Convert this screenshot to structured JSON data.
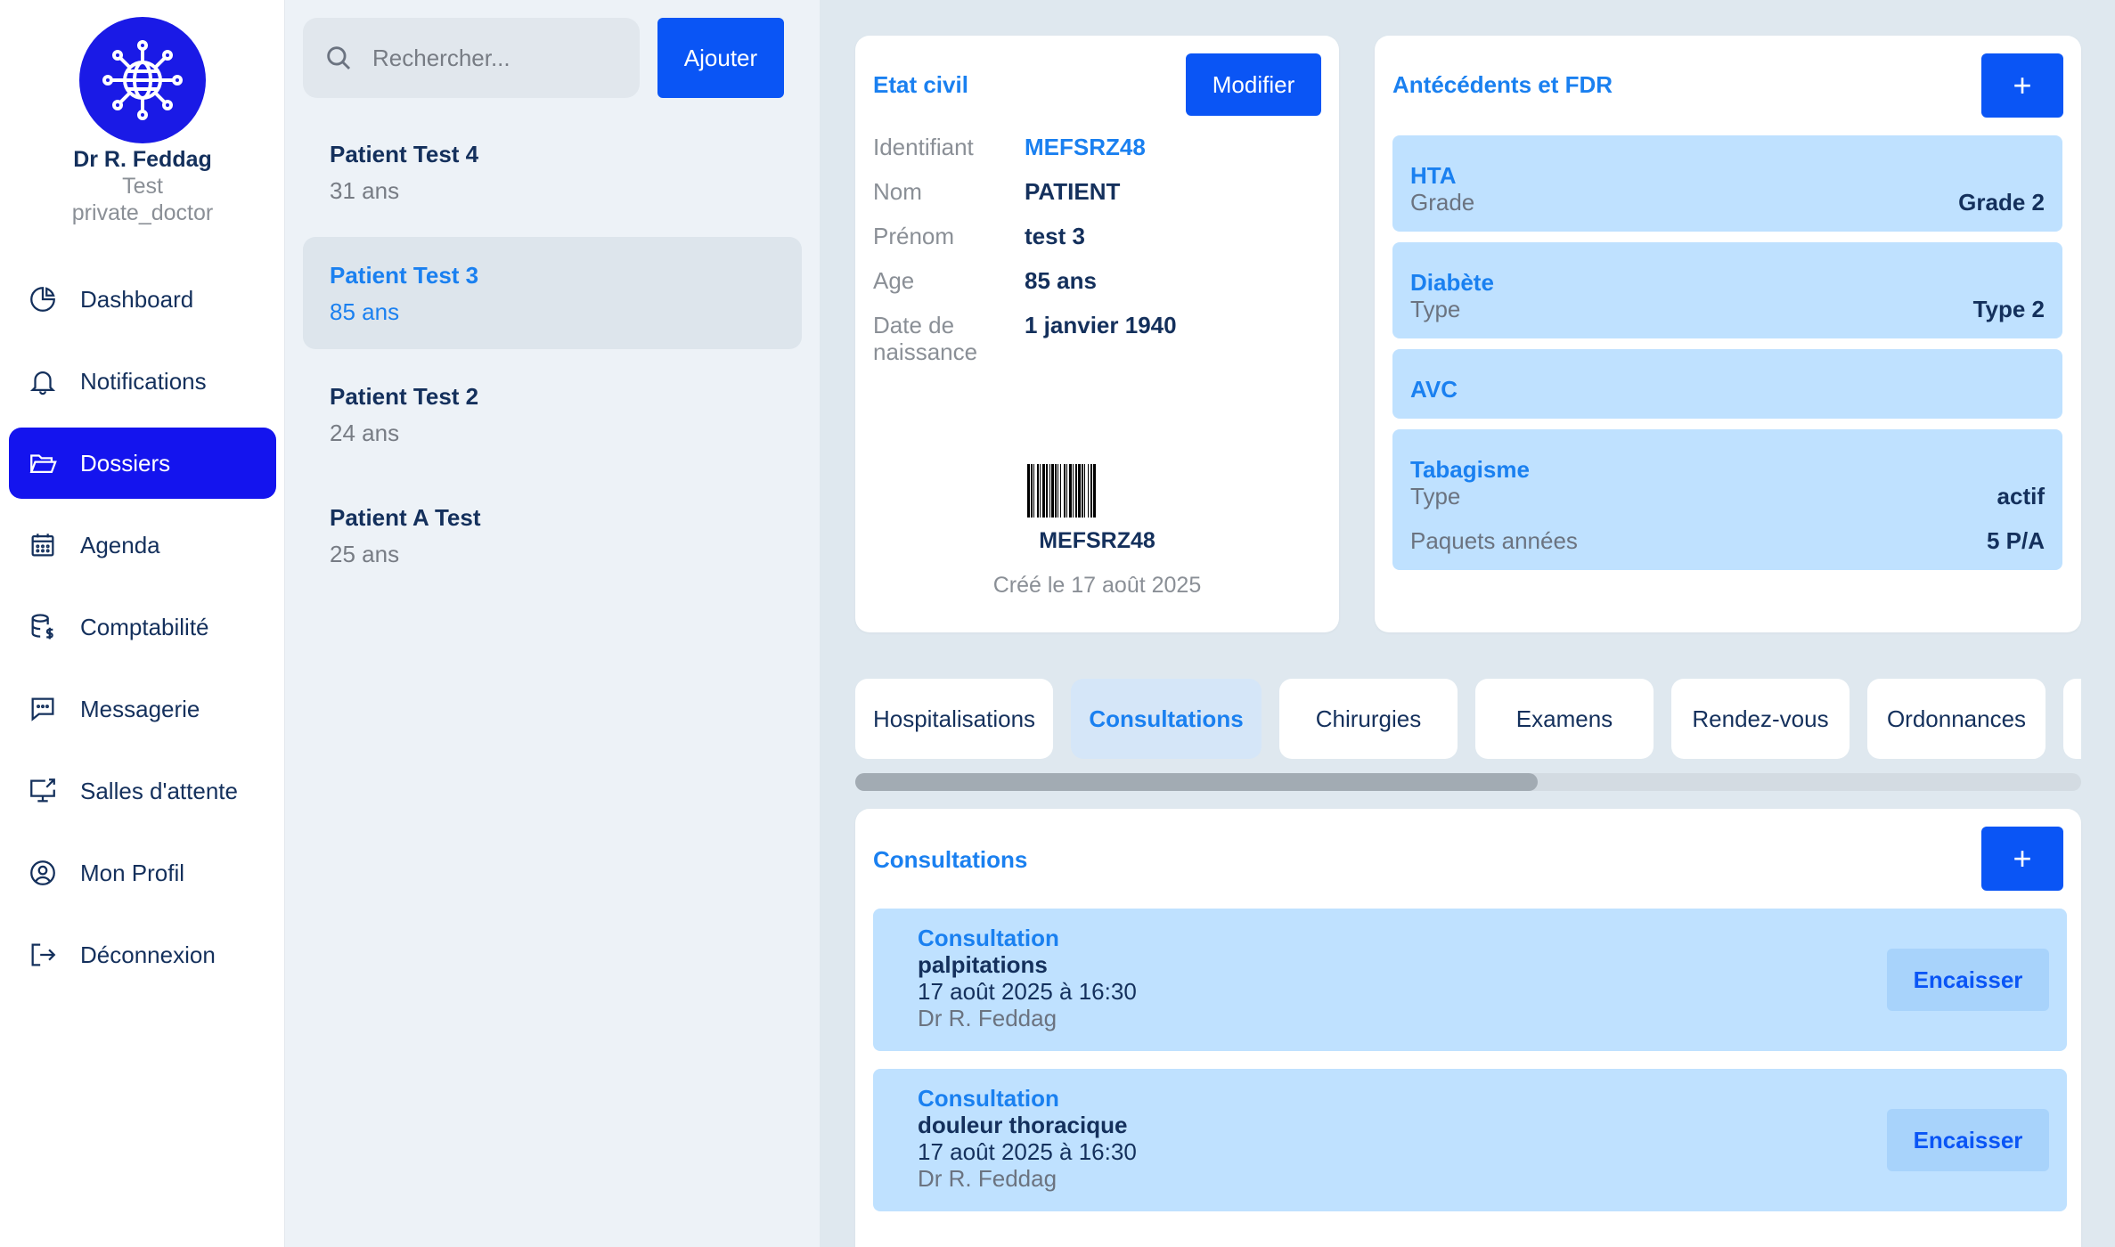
{
  "doctor": {
    "name": "Dr R. Feddag",
    "subtitle": "Test",
    "role": "private_doctor",
    "logo_icon": "network-globe-icon"
  },
  "nav": [
    {
      "label": "Dashboard",
      "icon": "pie-chart-icon"
    },
    {
      "label": "Notifications",
      "icon": "bell-icon"
    },
    {
      "label": "Dossiers",
      "icon": "folder-open-icon",
      "active": true
    },
    {
      "label": "Agenda",
      "icon": "calendar-icon"
    },
    {
      "label": "Comptabilité",
      "icon": "database-dollar-icon"
    },
    {
      "label": "Messagerie",
      "icon": "message-icon"
    },
    {
      "label": "Salles d'attente",
      "icon": "monitor-icon"
    },
    {
      "label": "Mon Profil",
      "icon": "user-circle-icon"
    },
    {
      "label": "Déconnexion",
      "icon": "logout-icon"
    }
  ],
  "search": {
    "placeholder": "Rechercher...",
    "value": ""
  },
  "add_button": "Ajouter",
  "patients": [
    {
      "name": "Patient Test 4",
      "age": "31 ans"
    },
    {
      "name": "Patient Test 3",
      "age": "85 ans",
      "active": true
    },
    {
      "name": "Patient Test 2",
      "age": "24 ans"
    },
    {
      "name": "Patient A Test",
      "age": "25 ans"
    }
  ],
  "etat_civil": {
    "title": "Etat civil",
    "edit_button": "Modifier",
    "fields": [
      {
        "label": "Identifiant",
        "value": "MEFSRZ48"
      },
      {
        "label": "Nom",
        "value": "PATIENT"
      },
      {
        "label": "Prénom",
        "value": "test 3"
      },
      {
        "label": "Age",
        "value": "85 ans"
      },
      {
        "label": "Date de naissance",
        "value": "1 janvier 1940"
      }
    ],
    "barcode_text": "MEFSRZ48",
    "created": "Créé le 17 août 2025"
  },
  "antecedents": {
    "title": "Antécédents et FDR",
    "add_button": "+",
    "items": [
      {
        "title": "HTA",
        "rows": [
          {
            "label": "Grade",
            "value": "Grade 2"
          }
        ]
      },
      {
        "title": "Diabète",
        "rows": [
          {
            "label": "Type",
            "value": "Type 2"
          }
        ]
      },
      {
        "title": "AVC",
        "rows": []
      },
      {
        "title": "Tabagisme",
        "rows": [
          {
            "label": "Type",
            "value": "actif"
          },
          {
            "label": "Paquets années",
            "value": "5 P/A"
          }
        ]
      }
    ]
  },
  "tabs": [
    {
      "label": "Hospitalisations"
    },
    {
      "label": "Consultations",
      "active": true
    },
    {
      "label": "Chirurgies"
    },
    {
      "label": "Examens"
    },
    {
      "label": "Rendez-vous"
    },
    {
      "label": "Ordonnances"
    }
  ],
  "consultations": {
    "title": "Consultations",
    "add_button": "+",
    "items": [
      {
        "type": "Consultation",
        "motif": "palpitations",
        "date": "17 août 2025 à 16:30",
        "doctor": "Dr R. Feddag",
        "action": "Encaisser"
      },
      {
        "type": "Consultation",
        "motif": "douleur thoracique",
        "date": "17 août 2025 à 16:30",
        "doctor": "Dr R. Feddag",
        "action": "Encaisser"
      }
    ]
  },
  "colors": {
    "primary": "#0a55f5",
    "accent_text": "#1a80f0",
    "nav_active": "#1414ee",
    "item_bg": "#bfe1ff",
    "text_dark": "#14305c"
  }
}
